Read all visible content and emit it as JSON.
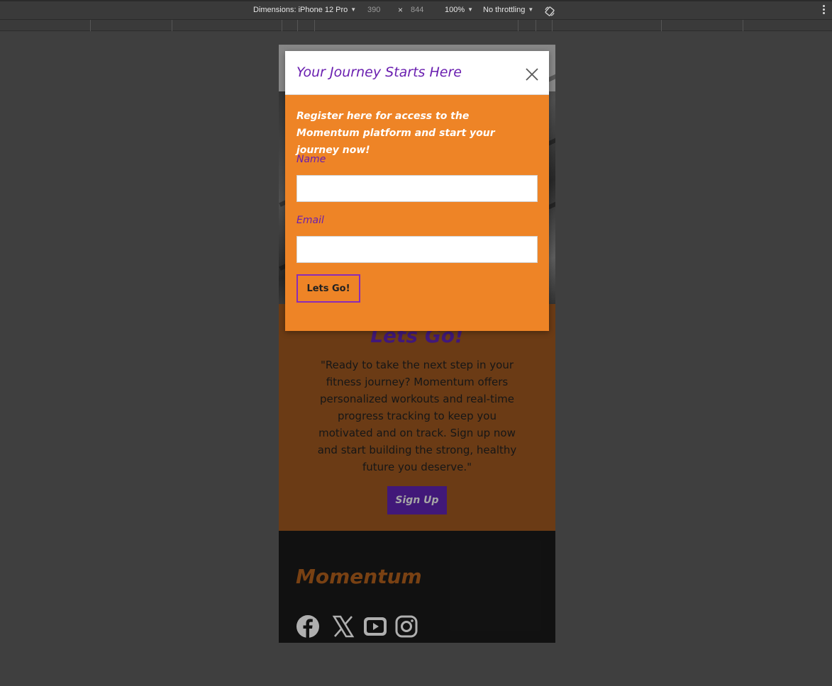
{
  "devtools": {
    "dimensions_label": "Dimensions: iPhone 12 Pro",
    "width_value": "390",
    "times": "×",
    "height_value": "844",
    "zoom": "100%",
    "throttling": "No throttling"
  },
  "modal": {
    "title": "Your Journey Starts Here",
    "intro": "Register here for access to the Momentum platform and start your journey now!",
    "name_label": "Name",
    "name_value": "",
    "email_label": "Email",
    "email_value": "",
    "submit_label": "Lets Go!"
  },
  "cta": {
    "heading": "Lets Go!",
    "text": "\"Ready to take the next step in your fitness journey? Momentum offers personalized workouts and real-time progress tracking to keep you motivated and on track. Sign up now and start building the strong, healthy future you deserve.\"",
    "button": "Sign Up"
  },
  "footer": {
    "brand": "Momentum",
    "socials": [
      "facebook-icon",
      "x-icon",
      "youtube-icon",
      "instagram-icon"
    ]
  },
  "colors": {
    "modal_body": "#ee8426",
    "accent_purple": "#6a1fb0",
    "section_brown": "#7a4418",
    "footer_dark": "#141414",
    "brand_orange": "#8a4a16"
  }
}
